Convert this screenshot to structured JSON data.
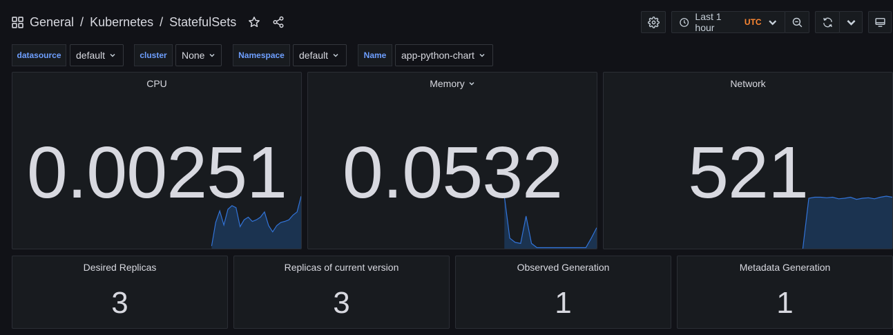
{
  "breadcrumb": {
    "root": "General",
    "separator": "/",
    "folder": "Kubernetes",
    "dashboard": "StatefulSets"
  },
  "toolbar": {
    "time_range": "Last 1 hour",
    "timezone": "UTC"
  },
  "variables": [
    {
      "label": "datasource",
      "value": "default"
    },
    {
      "label": "cluster",
      "value": "None"
    },
    {
      "label": "Namespace",
      "value": "default"
    },
    {
      "label": "Name",
      "value": "app-python-chart"
    }
  ],
  "stat_panels": [
    {
      "title": "CPU",
      "value": "0.00251",
      "has_menu": false,
      "sparkline": [
        0.05,
        0.5,
        0.72,
        0.45,
        0.75,
        0.82,
        0.78,
        0.42,
        0.55,
        0.6,
        0.52,
        0.55,
        0.6,
        0.7,
        0.44,
        0.32,
        0.44,
        0.5,
        0.52,
        0.55,
        0.64,
        0.7,
        1.0
      ]
    },
    {
      "title": "Memory",
      "value": "0.0532",
      "has_menu": true,
      "sparkline": [
        1.0,
        0.2,
        0.12,
        0.1,
        0.62,
        0.1,
        0.02,
        0.02,
        0.02,
        0.02,
        0.02,
        0.02,
        0.02,
        0.02,
        0.02,
        0.02,
        0.2,
        0.4
      ]
    },
    {
      "title": "Network",
      "value": "521",
      "has_menu": false,
      "sparkline": [
        0.0,
        0.96,
        0.98,
        0.98,
        0.97,
        0.98,
        0.95,
        0.96,
        0.98,
        0.94,
        0.96,
        0.97,
        0.95,
        0.98,
        1.0,
        0.98
      ]
    }
  ],
  "count_panels": [
    {
      "title": "Desired Replicas",
      "value": "3"
    },
    {
      "title": "Replicas of current version",
      "value": "3"
    },
    {
      "title": "Observed Generation",
      "value": "1"
    },
    {
      "title": "Metadata Generation",
      "value": "1"
    }
  ],
  "colors": {
    "background": "#111217",
    "panel": "#181b1f",
    "sparkline_stroke": "#3274d9",
    "sparkline_fill": "#1b3350",
    "variable_label": "#6e9fff",
    "utc_badge": "#ff8833"
  }
}
